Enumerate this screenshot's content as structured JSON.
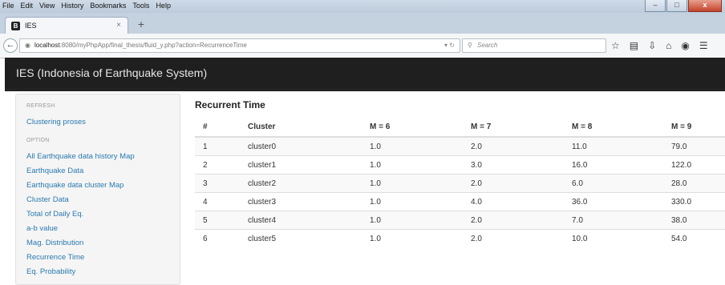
{
  "menu": [
    "File",
    "Edit",
    "View",
    "History",
    "Bookmarks",
    "Tools",
    "Help"
  ],
  "window_buttons": {
    "minimize": "–",
    "maximize": "□",
    "close": "x"
  },
  "tab": {
    "favicon": "B",
    "title": "IES",
    "close": "×",
    "new_tab": "+"
  },
  "nav": {
    "back": "←",
    "url_host": "localhost",
    "url_rest": ":8080/myPhpApp/final_thesis/fluid_y.php?action=RecurrenceTime",
    "search_placeholder": "Search"
  },
  "icons": [
    "star-icon",
    "clipboard-icon",
    "download-icon",
    "home-icon",
    "chat-icon",
    "menu-icon"
  ],
  "app": {
    "title": "IES (Indonesia of Earthquake System)"
  },
  "sidebar": {
    "refresh_header": "REFRESH",
    "refresh_items": [
      "Clustering proses"
    ],
    "option_header": "OPTION",
    "option_items": [
      "All Earthquake data history Map",
      "Earthquake Data",
      "Earthquake data cluster Map",
      "Cluster Data",
      "Total of Daily Eq.",
      "a-b value",
      "Mag. Distribution",
      "Recurrence Time",
      "Eq. Probability"
    ]
  },
  "main": {
    "title": "Recurrent Time",
    "columns": [
      "#",
      "Cluster",
      "M = 6",
      "M = 7",
      "M = 8",
      "M = 9"
    ],
    "rows": [
      [
        "1",
        "cluster0",
        "1.0",
        "2.0",
        "11.0",
        "79.0"
      ],
      [
        "2",
        "cluster1",
        "1.0",
        "3.0",
        "16.0",
        "122.0"
      ],
      [
        "3",
        "cluster2",
        "1.0",
        "2.0",
        "6.0",
        "28.0"
      ],
      [
        "4",
        "cluster3",
        "1.0",
        "4.0",
        "36.0",
        "330.0"
      ],
      [
        "5",
        "cluster4",
        "1.0",
        "2.0",
        "7.0",
        "38.0"
      ],
      [
        "6",
        "cluster5",
        "1.0",
        "2.0",
        "10.0",
        "54.0"
      ]
    ]
  },
  "colors": {
    "header_bg": "#1f1f1f",
    "link": "#2a7ab0",
    "sidebar_bg": "#f5f5f5"
  }
}
